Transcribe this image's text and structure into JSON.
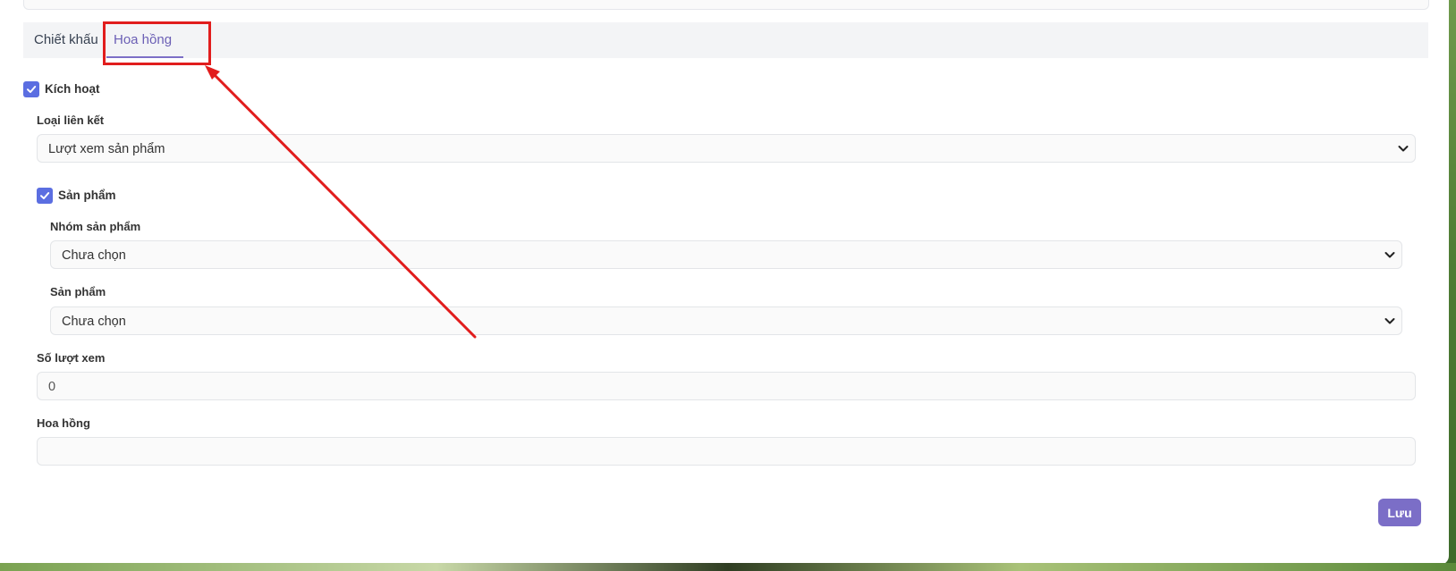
{
  "tabs": [
    {
      "label": "Chiết khấu",
      "active": false
    },
    {
      "label": "Hoa hồng",
      "active": true
    }
  ],
  "form": {
    "activate_label": "Kích hoạt",
    "activate_checked": true,
    "link_type_label": "Loại liên kết",
    "link_type_value": "Lượt xem sản phẩm",
    "product_check_label": "Sản phẩm",
    "product_checked": true,
    "product_group_label": "Nhóm sản phẩm",
    "product_group_value": "Chưa chọn",
    "product_label": "Sản phẩm",
    "product_value": "Chưa chọn",
    "view_count_label": "Số lượt xem",
    "view_count_value": "0",
    "commission_label": "Hoa hồng",
    "commission_value": ""
  },
  "buttons": {
    "save_label": "Lưu"
  },
  "colors": {
    "accent": "#7b6ec7",
    "checkbox": "#5b6ee1",
    "annotation": "#e11d1d"
  }
}
